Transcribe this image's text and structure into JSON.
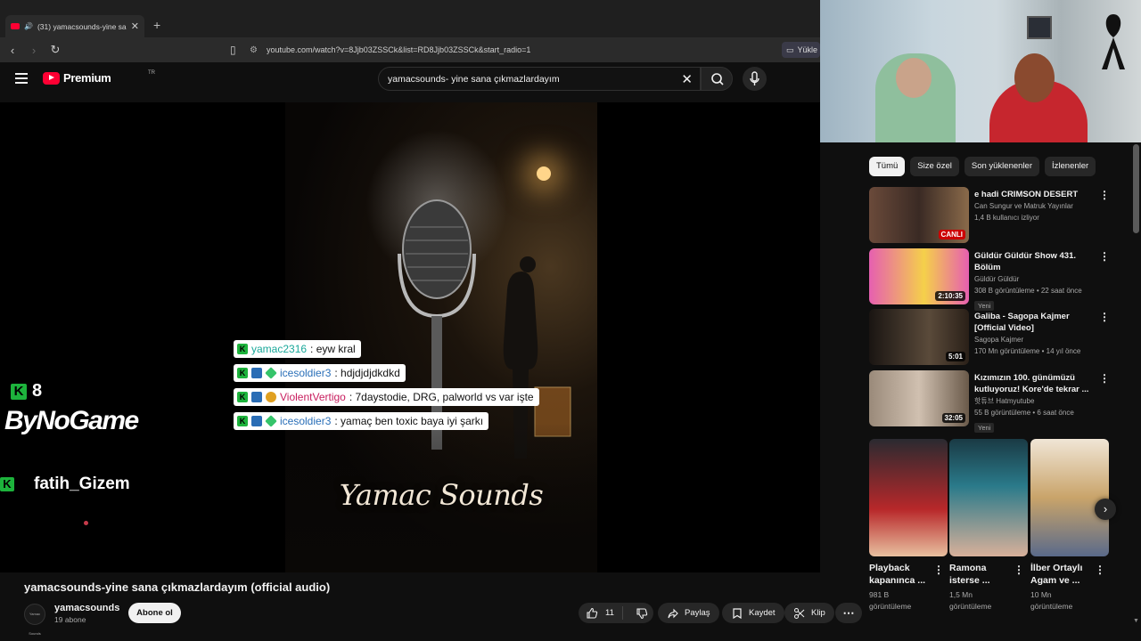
{
  "browser": {
    "tab_title": "(31) yamacsounds-yine sana",
    "url": "youtube.com/watch?v=8Jjb03ZSSCk&list=RD8Jjb03ZSSCk&start_radio=1",
    "install_label": "Yükle"
  },
  "header": {
    "logo_text": "Premium",
    "logo_country": "TR",
    "search_value": "yamacsounds- yine sana çıkmazlardayım"
  },
  "art": {
    "brand_text": "Yamac Sounds"
  },
  "chat": [
    {
      "user": "yamac2316",
      "color": "#1aa89a",
      "message": " : eyw kral"
    },
    {
      "user": "icesoldier3",
      "color": "#2a6fb8",
      "message": " : hdjdjdjdkdkd"
    },
    {
      "user": "ViolentVertigo",
      "color": "#c81d5e",
      "message": " : 7daystodie, DRG, palworld vs var işte"
    },
    {
      "user": "icesoldier3",
      "color": "#2a6fb8",
      "message": " : yamaç ben toxic baya iyi şarkı"
    }
  ],
  "overlay": {
    "viewer_count": "8",
    "streamer": "ByNoGame",
    "follower": "fatih_Gizem"
  },
  "video": {
    "title": "yamacsounds-yine sana çıkmazlardayım (official audio)",
    "channel": "yamacsounds",
    "subs": "19 abone",
    "avatar_text": "Yamac Sounds",
    "subscribe": "Abone ol",
    "likes": "11",
    "share": "Paylaş",
    "save": "Kaydet",
    "clip": "Klip"
  },
  "sidebar": {
    "chips": [
      "Tümü",
      "Size özel",
      "Son yüklenenler",
      "İzlenenler"
    ],
    "recs": [
      {
        "title": "e hadi CRIMSON DESERT",
        "channel": "Can Sungur ve Matruk Yayınlar",
        "meta": "1,4 B kullanıcı izliyor",
        "badge": "CANLI",
        "new": "",
        "thumb": "#4a3a2e"
      },
      {
        "title": "Güldür Güldür Show 431. Bölüm",
        "channel": "Güldür Güldür",
        "meta": "308 B görüntüleme • 22 saat önce",
        "badge": "2:10:35",
        "new": "Yeni",
        "thumb": "#d85aa8"
      },
      {
        "title": "Galiba - Sagopa Kajmer [Official Video]",
        "channel": "Sagopa Kajmer",
        "meta": "170 Mn görüntüleme • 14 yıl önce",
        "badge": "5:01",
        "new": "",
        "thumb": "#2a2420"
      },
      {
        "title": "Kızımızın 100. günümüzü kutluyoruz! Kore'de tekrar ...",
        "channel": "핫튜브 Hatmyutube",
        "meta": "55 B görüntüleme • 6 saat önce",
        "badge": "32:05",
        "new": "Yeni",
        "thumb": "#8a7a6a"
      }
    ],
    "shorts": [
      {
        "title": "Playback kapanınca ...",
        "views": "981 B görüntüleme",
        "thumb": "#b8282a"
      },
      {
        "title": "Ramona isterse ...",
        "views": "1,5 Mn görüntüleme",
        "thumb": "#2a7a8a"
      },
      {
        "title": "İlber Ortaylı Agam ve ...",
        "views": "10 Mn görüntüleme",
        "thumb": "#c9a46a"
      }
    ]
  }
}
